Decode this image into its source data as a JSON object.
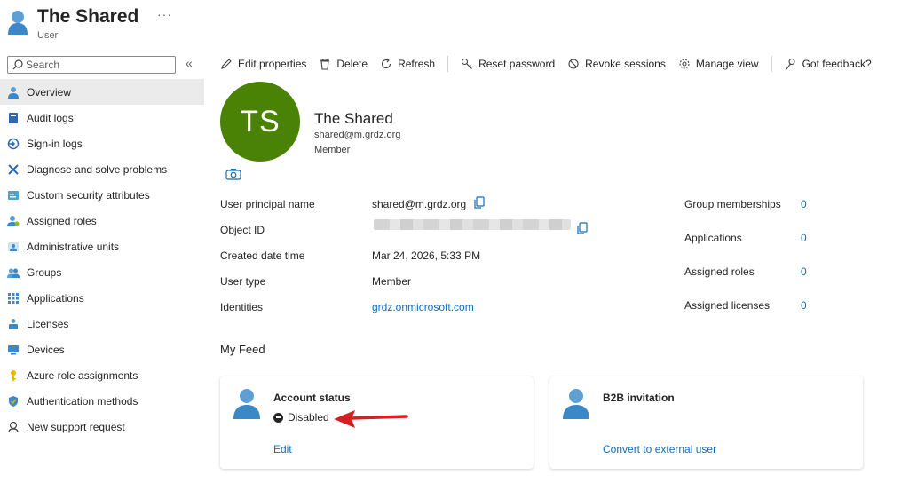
{
  "header": {
    "title": "The Shared",
    "subtitle": "User",
    "more": "···"
  },
  "sidebar": {
    "search_placeholder": "Search",
    "collapse": "«",
    "items": [
      {
        "label": "Overview",
        "icon": "person-icon"
      },
      {
        "label": "Audit logs",
        "icon": "book-icon"
      },
      {
        "label": "Sign-in logs",
        "icon": "sign-in-icon"
      },
      {
        "label": "Diagnose and solve problems",
        "icon": "tools-icon"
      },
      {
        "label": "Custom security attributes",
        "icon": "tag-icon"
      },
      {
        "label": "Assigned roles",
        "icon": "role-icon"
      },
      {
        "label": "Administrative units",
        "icon": "admin-unit-icon"
      },
      {
        "label": "Groups",
        "icon": "groups-icon"
      },
      {
        "label": "Applications",
        "icon": "grid-icon"
      },
      {
        "label": "Licenses",
        "icon": "license-icon"
      },
      {
        "label": "Devices",
        "icon": "device-icon"
      },
      {
        "label": "Azure role assignments",
        "icon": "key-icon"
      },
      {
        "label": "Authentication methods",
        "icon": "shield-icon"
      },
      {
        "label": "New support request",
        "icon": "support-icon"
      }
    ]
  },
  "toolbar": {
    "edit": "Edit properties",
    "delete": "Delete",
    "refresh": "Refresh",
    "reset_password": "Reset password",
    "revoke_sessions": "Revoke sessions",
    "manage_view": "Manage view",
    "feedback": "Got feedback?"
  },
  "profile": {
    "initials": "TS",
    "name": "The Shared",
    "email": "shared@m.grdz.org",
    "type": "Member",
    "avatar_color": "#498205"
  },
  "properties": [
    {
      "label": "User principal name",
      "value": "shared@m.grdz.org"
    },
    {
      "label": "Object ID",
      "value": ""
    },
    {
      "label": "Created date time",
      "value": "Mar 24, 2026, 5:33 PM"
    },
    {
      "label": "User type",
      "value": "Member"
    },
    {
      "label": "Identities",
      "value": "grdz.onmicrosoft.com"
    }
  ],
  "stats": [
    {
      "label": "Group memberships",
      "value": "0"
    },
    {
      "label": "Applications",
      "value": "0"
    },
    {
      "label": "Assigned roles",
      "value": "0"
    },
    {
      "label": "Assigned licenses",
      "value": "0"
    }
  ],
  "feed": {
    "title": "My Feed",
    "account_status": {
      "title": "Account status",
      "status": "Disabled",
      "link": "Edit"
    },
    "b2b": {
      "title": "B2B invitation",
      "link": "Convert to external user"
    }
  },
  "colors": {
    "accent": "#0f6cbd",
    "annotation_arrow": "#d42020"
  }
}
